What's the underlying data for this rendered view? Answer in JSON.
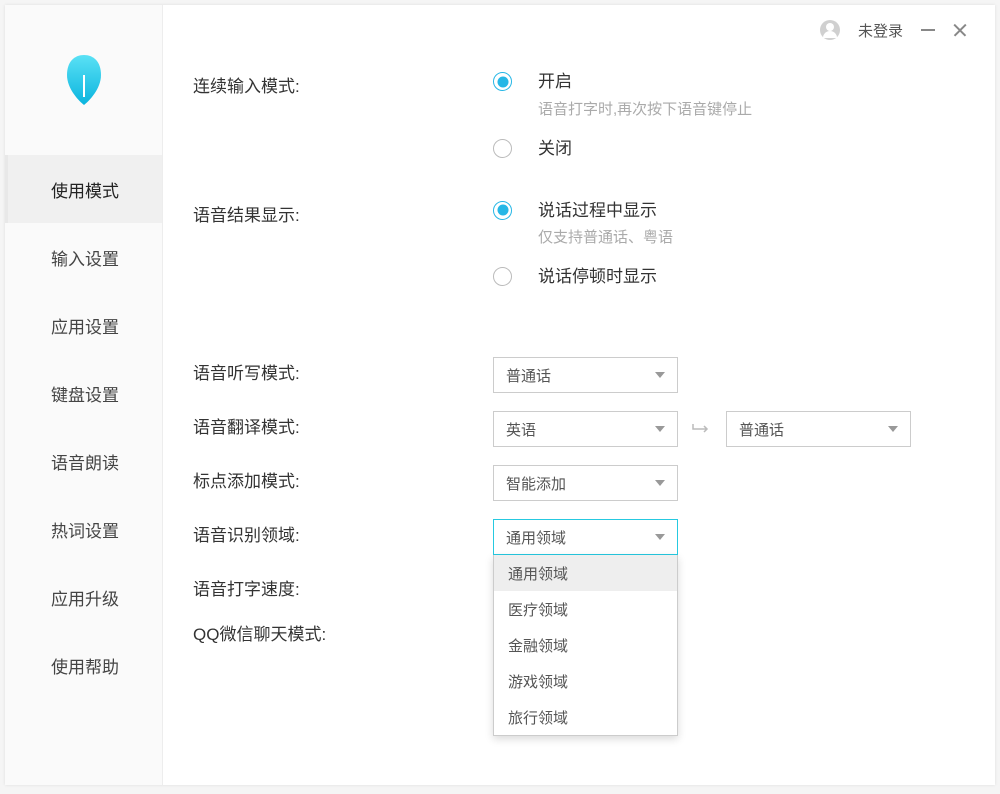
{
  "titlebar": {
    "login_status": "未登录"
  },
  "sidebar": {
    "items": [
      {
        "label": "使用模式",
        "active": true
      },
      {
        "label": "输入设置",
        "active": false
      },
      {
        "label": "应用设置",
        "active": false
      },
      {
        "label": "键盘设置",
        "active": false
      },
      {
        "label": "语音朗读",
        "active": false
      },
      {
        "label": "热词设置",
        "active": false
      },
      {
        "label": "应用升级",
        "active": false
      },
      {
        "label": "使用帮助",
        "active": false
      }
    ]
  },
  "settings": {
    "continuous_input": {
      "label": "连续输入模式:",
      "options": [
        {
          "label": "开启",
          "hint": "语音打字时,再次按下语音键停止",
          "selected": true
        },
        {
          "label": "关闭",
          "hint": "",
          "selected": false
        }
      ]
    },
    "voice_result_display": {
      "label": "语音结果显示:",
      "options": [
        {
          "label": "说话过程中显示",
          "hint": "仅支持普通话、粤语",
          "selected": true
        },
        {
          "label": "说话停顿时显示",
          "hint": "",
          "selected": false
        }
      ]
    },
    "dictation_mode": {
      "label": "语音听写模式:",
      "value": "普通话"
    },
    "translation_mode": {
      "label": "语音翻译模式:",
      "from": "英语",
      "to": "普通话"
    },
    "punctuation_mode": {
      "label": "标点添加模式:",
      "value": "智能添加"
    },
    "recognition_domain": {
      "label": "语音识别领域:",
      "value": "通用领域",
      "options": [
        "通用领域",
        "医疗领域",
        "金融领域",
        "游戏领域",
        "旅行领域"
      ],
      "highlighted_index": 0,
      "open": true
    },
    "typing_speed": {
      "label": "语音打字速度:"
    },
    "chat_mode": {
      "label": "QQ微信聊天模式:"
    }
  }
}
